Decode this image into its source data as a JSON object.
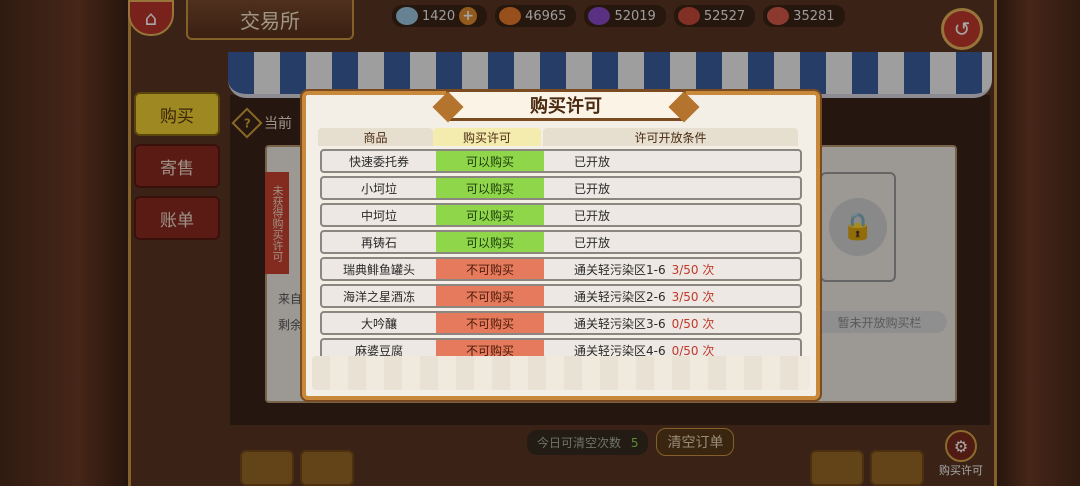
{
  "header": {
    "title": "交易所",
    "resources": [
      {
        "icon": "diamond-icon",
        "value": "1420",
        "color": "#9bc7e0"
      },
      {
        "icon": "potion-icon",
        "value": "46965",
        "color": "#e87a2a"
      },
      {
        "icon": "crystal-icon",
        "value": "52019",
        "color": "#8a4ac8"
      },
      {
        "icon": "food-icon",
        "value": "52527",
        "color": "#c84a3a"
      },
      {
        "icon": "meat-icon",
        "value": "35281",
        "color": "#d85a4a"
      }
    ]
  },
  "tabs": [
    {
      "label": "购买"
    },
    {
      "label": "寄售"
    },
    {
      "label": "账单"
    }
  ],
  "current_label": "当前",
  "background": {
    "ribbon": "未获得购买许可",
    "label_a": "来自",
    "label_b": "剩余",
    "open_bar": "暂未开放购买栏"
  },
  "bottom": {
    "clear_count_label": "今日可清空次数",
    "clear_count": "5",
    "clear_button": "清空订单",
    "permit_button": "购买许可"
  },
  "modal": {
    "title": "购买许可",
    "headers": [
      "商品",
      "购买许可",
      "许可开放条件"
    ],
    "rows": [
      {
        "item": "快速委托券",
        "permit": "可以购买",
        "ok": true,
        "condition": "已开放",
        "count": ""
      },
      {
        "item": "小坷垃",
        "permit": "可以购买",
        "ok": true,
        "condition": "已开放",
        "count": ""
      },
      {
        "item": "中坷垃",
        "permit": "可以购买",
        "ok": true,
        "condition": "已开放",
        "count": ""
      },
      {
        "item": "再铸石",
        "permit": "可以购买",
        "ok": true,
        "condition": "已开放",
        "count": ""
      },
      {
        "item": "瑞典鲱鱼罐头",
        "permit": "不可购买",
        "ok": false,
        "condition": "通关轻污染区1-6",
        "count": "3/50 次"
      },
      {
        "item": "海洋之星酒冻",
        "permit": "不可购买",
        "ok": false,
        "condition": "通关轻污染区2-6",
        "count": "3/50 次"
      },
      {
        "item": "大吟釀",
        "permit": "不可购买",
        "ok": false,
        "condition": "通关轻污染区3-6",
        "count": "0/50 次"
      },
      {
        "item": "麻婆豆腐",
        "permit": "不可购买",
        "ok": false,
        "condition": "通关轻污染区4-6",
        "count": "0/50 次"
      }
    ]
  }
}
